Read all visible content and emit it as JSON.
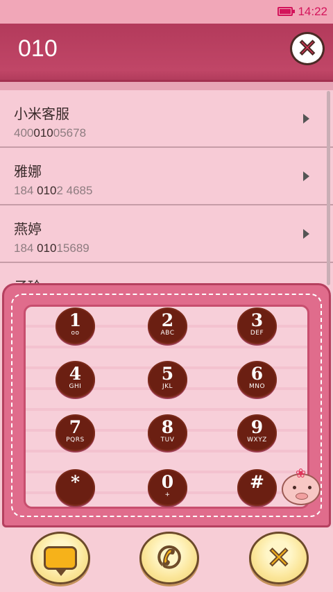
{
  "status_bar": {
    "time": "14:22",
    "icon": "battery-icon"
  },
  "header": {
    "dialed": "010",
    "clear_icon": "close-icon"
  },
  "contacts": [
    {
      "name": "小米客服",
      "number_pre": "400",
      "number_match": "010",
      "number_post": "05678"
    },
    {
      "name": "雅娜",
      "number_pre": "184 ",
      "number_match": "010",
      "number_post": "2 4685"
    },
    {
      "name": "燕婷",
      "number_pre": "184 ",
      "number_match": "010",
      "number_post": "15689"
    },
    {
      "name": "子玲",
      "number_pre": "",
      "number_match": "",
      "number_post": ""
    }
  ],
  "keypad": {
    "keys": [
      {
        "digit": "1",
        "letters": "oo"
      },
      {
        "digit": "2",
        "letters": "ABC"
      },
      {
        "digit": "3",
        "letters": "DEF"
      },
      {
        "digit": "4",
        "letters": "GHI"
      },
      {
        "digit": "5",
        "letters": "JKL"
      },
      {
        "digit": "6",
        "letters": "MNO"
      },
      {
        "digit": "7",
        "letters": "PQRS"
      },
      {
        "digit": "8",
        "letters": "TUV"
      },
      {
        "digit": "9",
        "letters": "WXYZ"
      },
      {
        "digit": "*",
        "letters": ""
      },
      {
        "digit": "0",
        "letters": "+"
      },
      {
        "digit": "#",
        "letters": ""
      }
    ]
  },
  "actions": {
    "message_icon": "message-icon",
    "call_icon": "phone-icon",
    "close_icon": "close-icon",
    "call_glyph": "✆",
    "close_glyph": "✕"
  },
  "colors": {
    "accent": "#c04667",
    "key": "#6b1f12",
    "status_text": "#d3145b"
  }
}
